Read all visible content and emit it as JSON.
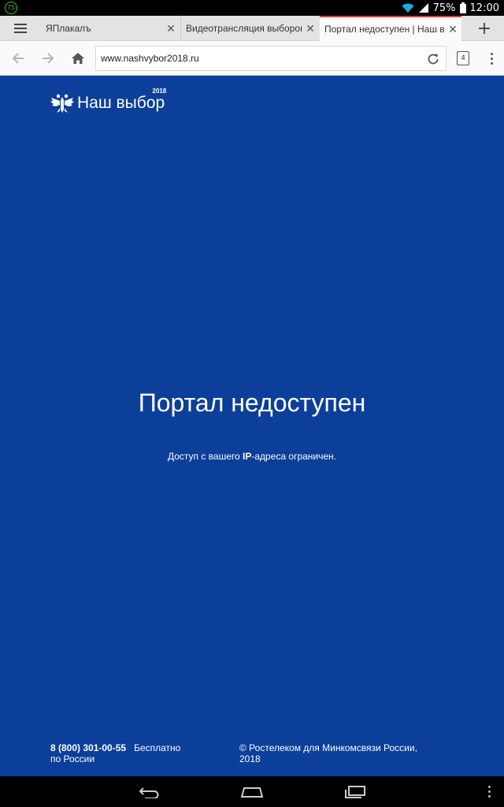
{
  "status_bar": {
    "notification_badge": "75",
    "battery": "75%",
    "time": "12:00"
  },
  "tabs": [
    {
      "title": "ЯПлакалъ",
      "close": "✕"
    },
    {
      "title": "Видеотрансляция выборов",
      "close": "✕"
    },
    {
      "title": "Портал недоступен | Наш выбор",
      "close": "✕"
    }
  ],
  "new_tab_label": "+",
  "toolbar": {
    "url": "www.nashvybor2018.ru",
    "tab_count": "4"
  },
  "page": {
    "logo_text": "Наш выбор",
    "logo_year": "2018",
    "headline": "Портал недоступен",
    "subline_before": "Доступ с вашего ",
    "subline_bold": "IP",
    "subline_after": "-адреса ограничен.",
    "phone": "8 (800) 301-00-55",
    "phone_note": "Бесплатно",
    "phone_note2": "по России",
    "copyright_line1": "© Ростелеком для Минкомсвязи России,",
    "copyright_line2": "2018"
  },
  "colors": {
    "page_background": "#0b3f9a",
    "active_tab_accent": "#e53935"
  },
  "icons": [
    "menu-icon",
    "close-icon",
    "plus-icon",
    "back-icon",
    "forward-icon",
    "home-icon",
    "reload-icon",
    "tabs-icon",
    "overflow-icon",
    "eagle-emblem-icon",
    "nav-back-icon",
    "nav-home-icon",
    "nav-recents-icon"
  ]
}
